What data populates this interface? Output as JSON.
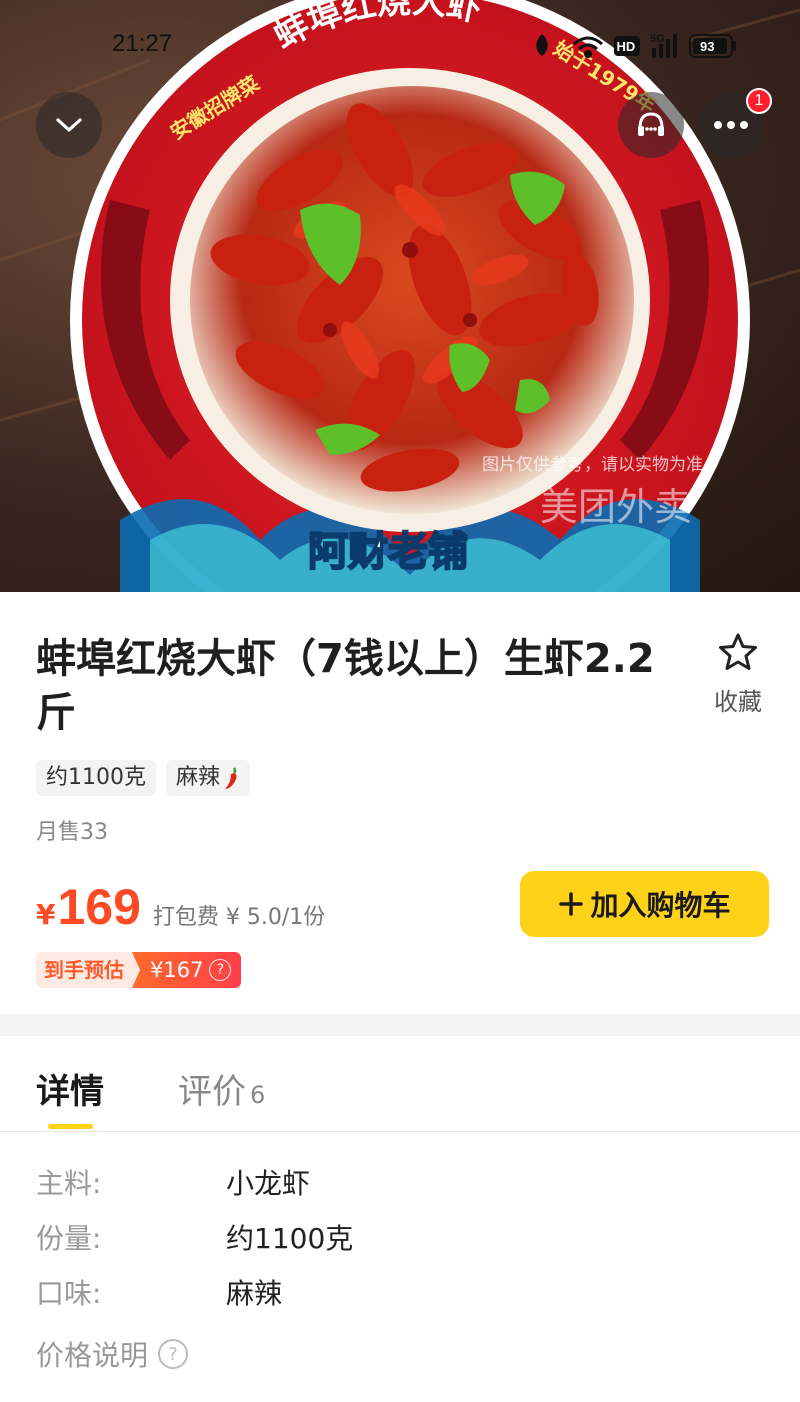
{
  "status_bar": {
    "time": "21:27",
    "hd": "HD",
    "network": "5G",
    "battery": "93"
  },
  "hero": {
    "plate_top_text": "蚌埠红烧大虾",
    "plate_left_text": "安徽招牌菜",
    "plate_right_text": "始于1979年",
    "plate_bottom_text": "阿财老铺",
    "disclaimer": "图片仅供参考，请以实物为准",
    "watermark": "美团外卖"
  },
  "header_buttons": {
    "more_badge": "1"
  },
  "product": {
    "title": "蚌埠红烧大虾（7钱以上）生虾2.2斤",
    "favorite_label": "收藏",
    "tags": [
      "约1100克",
      "麻辣"
    ],
    "monthly_sales": "月售33",
    "currency": "¥",
    "price": "169",
    "packaging_fee": "打包费 ¥ 5.0/1份",
    "add_to_cart": "加入购物车",
    "estimate_label": "到手预估",
    "estimate_value": "¥167"
  },
  "tabs": {
    "detail": "详情",
    "reviews": "评价",
    "reviews_count": "6"
  },
  "details": [
    {
      "key": "主料:",
      "value": "小龙虾"
    },
    {
      "key": "份量:",
      "value": "约1100克"
    },
    {
      "key": "口味:",
      "value": "麻辣"
    }
  ],
  "price_note": "价格说明",
  "colors": {
    "accent_yellow": "#ffd21a",
    "price_red": "#ff4a26",
    "badge_red": "#ff1d2e"
  },
  "icons": {
    "collapse": "chevron-down-icon",
    "service": "customer-service-icon",
    "more": "more-dots-icon",
    "favorite": "star-outline-icon",
    "spicy": "chili-pepper-icon",
    "help": "question-circle-icon"
  }
}
